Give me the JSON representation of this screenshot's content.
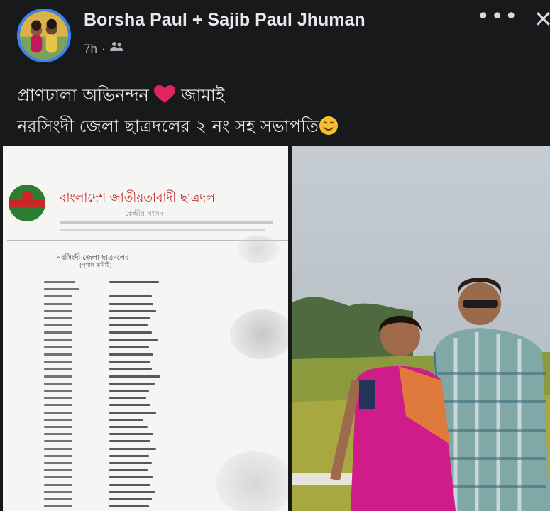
{
  "post": {
    "author_primary": "Borsha Paul",
    "plus": "+",
    "author_secondary": "Sajib Paul Jhuman",
    "time": "7h",
    "separator": "·",
    "audience_icon": "friends-icon",
    "more_label": "•••",
    "close_label": "✕",
    "caption_line1_a": "প্রাণঢালা অভিনন্দন",
    "caption_emoji1": "❤️",
    "caption_line1_b": "জামাই",
    "caption_line2": "নরসিংদী জেলা ছাত্রদলের ২ নং সহ সভাপতি",
    "caption_emoji2": "😊"
  },
  "document_image": {
    "org_title": "বাংলাদেশ জাতীয়তাবাদী ছাত্রদল",
    "org_subtitle": "কেন্দ্রীয় সংসদ",
    "list_heading": "নরসিংদী জেলা ছাত্রদলের",
    "list_subheading": "(পূর্ণাঙ্গ কমিটি)"
  },
  "colors": {
    "background": "#18191b",
    "avatar_ring": "#3b82f6",
    "heart": "#e0245e",
    "doc_title": "#c62828",
    "saree": "#d01b8a"
  }
}
